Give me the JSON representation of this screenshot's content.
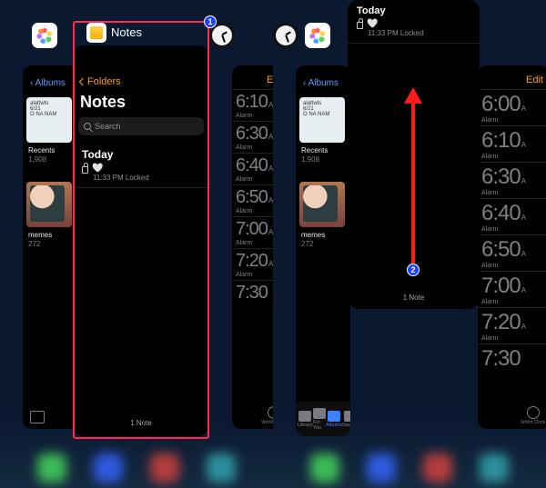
{
  "apps": {
    "photos_label": "Albums",
    "notes_label": "Notes",
    "thumb1_lines": "alattwts\n6/21\nO NA NAM",
    "recents_caption": "Recents",
    "recents_count": "1,908",
    "memes_caption": "memes",
    "memes_count": "272",
    "tabbar": {
      "library": "Library",
      "foryou": "For You",
      "albums": "Albums",
      "search": "Search"
    }
  },
  "clock": {
    "edit": "Edit",
    "alarms": [
      {
        "t": "6:00",
        "s": "A",
        "l": "Alarm"
      },
      {
        "t": "6:10",
        "s": "A",
        "l": "Alarm"
      },
      {
        "t": "6:30",
        "s": "A",
        "l": "Alarm"
      },
      {
        "t": "6:40",
        "s": "A",
        "l": "Alarm"
      },
      {
        "t": "6:50",
        "s": "A",
        "l": "Alarm"
      },
      {
        "t": "7:00",
        "s": "A",
        "l": "Alarm"
      },
      {
        "t": "7:20",
        "s": "A",
        "l": "Alarm"
      },
      {
        "t": "7:30",
        "s": "",
        "l": ""
      }
    ],
    "worldclock": "World Clock"
  },
  "notes": {
    "folders": "Folders",
    "title": "Notes",
    "search_ph": "Search",
    "section_today": "Today",
    "note_title_icon": "🤍",
    "note_meta": "11:33 PM  Locked",
    "footer": "1 Note"
  },
  "badges": {
    "b1": "1",
    "b2": "2"
  }
}
